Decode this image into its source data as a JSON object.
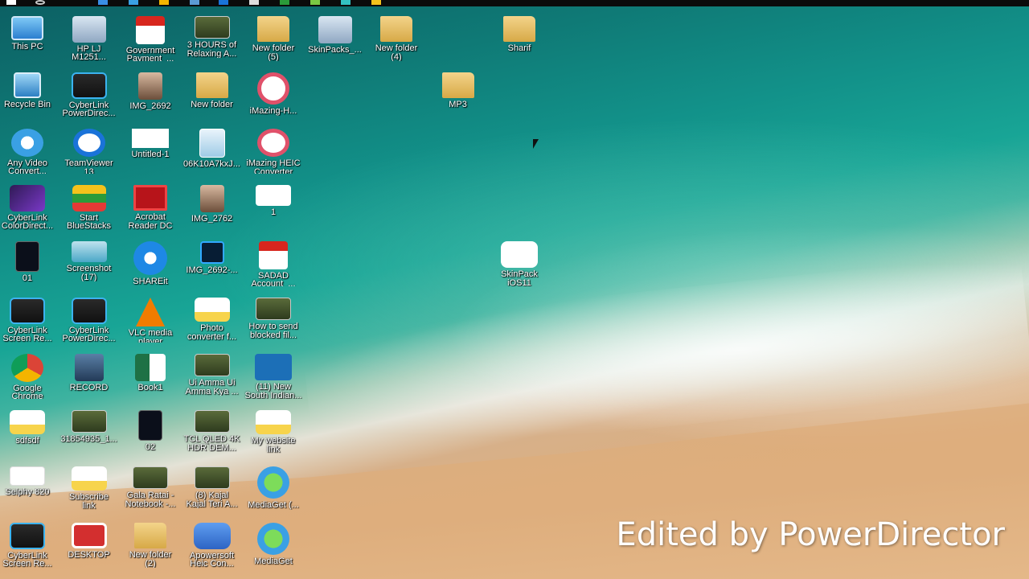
{
  "desktop": {
    "watermark": "Edited by PowerDirector",
    "icons": [
      {
        "label": "This PC",
        "glyph": "pc-icon"
      },
      {
        "label": "HP LJ\nM1251...",
        "glyph": "printer-icon"
      },
      {
        "label": "Government\nPayment_...",
        "glyph": "pdf-icon"
      },
      {
        "label": "3 HOURS of\nRelaxing A...",
        "glyph": "video-icon"
      },
      {
        "label": "New folder\n(5)",
        "glyph": "folder-icon"
      },
      {
        "label": "SkinPacks_...",
        "glyph": "package-icon"
      },
      {
        "label": "New folder\n(4)",
        "glyph": "folder-icon"
      },
      {
        "label": "Sharif",
        "glyph": "folder-icon"
      },
      {
        "label": "Recycle Bin",
        "glyph": "recycle-bin-icon"
      },
      {
        "label": "CyberLink\nPowerDirec...",
        "glyph": "cyberlink-icon"
      },
      {
        "label": "IMG_2692",
        "glyph": "photo-icon"
      },
      {
        "label": "New folder",
        "glyph": "folder-icon"
      },
      {
        "label": "iMazing-H...",
        "glyph": "heic-icon"
      },
      {
        "label": "MP3",
        "glyph": "folder-icon"
      },
      {
        "label": "Any Video\nConvert...",
        "glyph": "converter-icon"
      },
      {
        "label": "TeamViewer\n13",
        "glyph": "teamviewer-icon"
      },
      {
        "label": "Untitled-1",
        "glyph": "blank-file-icon"
      },
      {
        "label": "06K10A7kxJ...",
        "glyph": "image-file-icon"
      },
      {
        "label": "iMazing HEIC\nConverter",
        "glyph": "heic-icon"
      },
      {
        "label": "CyberLink\nColorDirect...",
        "glyph": "color-director-icon"
      },
      {
        "label": "Start\nBlueStacks",
        "glyph": "bluestacks-icon"
      },
      {
        "label": "Acrobat\nReader DC",
        "glyph": "acrobat-icon"
      },
      {
        "label": "IMG_2762",
        "glyph": "photo-icon"
      },
      {
        "label": "1",
        "glyph": "document-icon"
      },
      {
        "label": "01",
        "glyph": "video-file-icon"
      },
      {
        "label": "Screenshot\n(17)",
        "glyph": "screenshot-icon"
      },
      {
        "label": "SHAREit",
        "glyph": "shareit-icon"
      },
      {
        "label": "IMG_2692-...",
        "glyph": "photoshop-icon"
      },
      {
        "label": "SADAD\nAccount_...",
        "glyph": "pdf-icon"
      },
      {
        "label": "SkinPack\niOS11",
        "glyph": "skinpack-icon"
      },
      {
        "label": "CyberLink\nScreen Re...",
        "glyph": "cyberlink-icon"
      },
      {
        "label": "CyberLink\nPowerDirec...",
        "glyph": "cyberlink-icon"
      },
      {
        "label": "VLC media\nplayer",
        "glyph": "vlc-icon"
      },
      {
        "label": "Photo\nconverter f...",
        "glyph": "notes-icon"
      },
      {
        "label": "How to send\nblocked fil...",
        "glyph": "video-icon"
      },
      {
        "label": "Google\nChrome",
        "glyph": "chrome-icon"
      },
      {
        "label": "RECORD",
        "glyph": "record-icon"
      },
      {
        "label": "Book1",
        "glyph": "excel-icon"
      },
      {
        "label": "Ui Amma Ui\nAmma Kya ...",
        "glyph": "video-icon"
      },
      {
        "label": "(11) New\nSouth Indian...",
        "glyph": "mkv-icon"
      },
      {
        "label": "sdfsdf",
        "glyph": "notes-icon"
      },
      {
        "label": "31854935_1...",
        "glyph": "video-icon"
      },
      {
        "label": "02",
        "glyph": "video-file-icon"
      },
      {
        "label": "TCL QLED 4K\nHDR DEM...",
        "glyph": "video-icon"
      },
      {
        "label": "My website\nlink",
        "glyph": "notes-icon"
      },
      {
        "label": "Selphy 820",
        "glyph": "selphy-icon"
      },
      {
        "label": "Subscribe\nlink",
        "glyph": "notes-icon"
      },
      {
        "label": "Gala Ratai -\nNotebook -...",
        "glyph": "video-icon"
      },
      {
        "label": "(8) Kajal\nKajal Teri A...",
        "glyph": "video-icon"
      },
      {
        "label": "MediaGet (...",
        "glyph": "mediaget-icon"
      },
      {
        "label": "CyberLink\nScreen Re...",
        "glyph": "cyberlink-icon"
      },
      {
        "label": "DESKTOP",
        "glyph": "power-icon"
      },
      {
        "label": "New folder\n(2)",
        "glyph": "folder-icon"
      },
      {
        "label": "Apowersoft\nHeic Con...",
        "glyph": "heic-app-icon"
      },
      {
        "label": "MediaGet",
        "glyph": "mediaget-icon"
      }
    ]
  }
}
